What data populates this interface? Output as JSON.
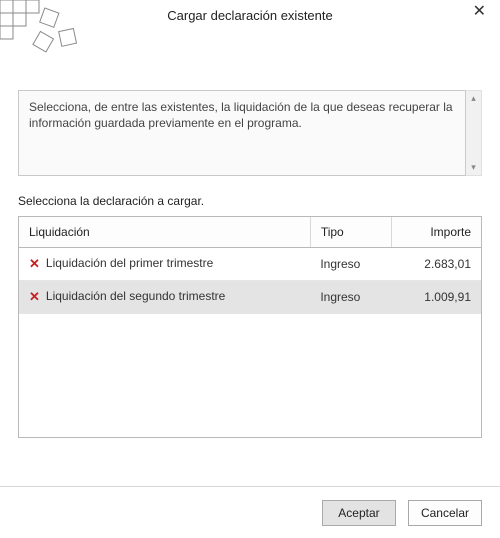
{
  "window": {
    "title": "Cargar declaración existente"
  },
  "instruction": "Selecciona, de entre las existentes, la liquidación de la que deseas recuperar la información guardada previamente en el programa.",
  "prompt": "Selecciona la declaración a cargar.",
  "table": {
    "headers": {
      "liquidacion": "Liquidación",
      "tipo": "Tipo",
      "importe": "Importe"
    },
    "rows": [
      {
        "name": "Liquidación del primer trimestre",
        "tipo": "Ingreso",
        "importe": "2.683,01",
        "selected": false
      },
      {
        "name": "Liquidación del segundo trimestre",
        "tipo": "Ingreso",
        "importe": "1.009,91",
        "selected": true
      }
    ]
  },
  "buttons": {
    "accept": "Aceptar",
    "cancel": "Cancelar"
  }
}
